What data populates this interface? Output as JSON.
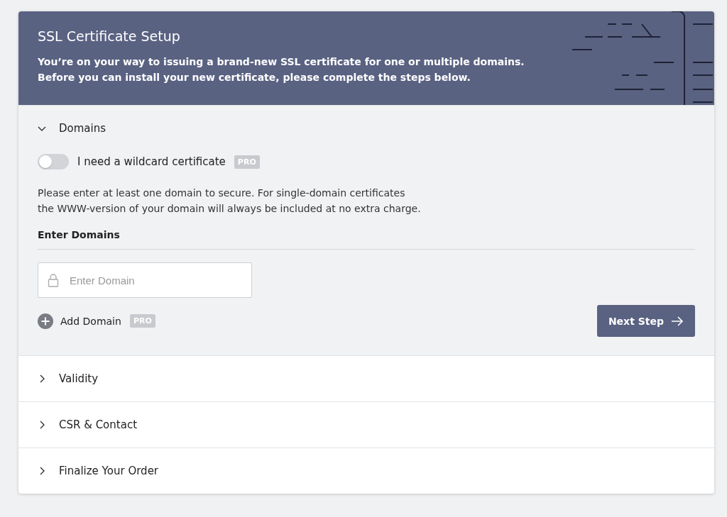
{
  "header": {
    "title": "SSL Certificate Setup",
    "description_lines": [
      "You’re on your way to issuing a brand-new SSL certificate for one or multiple domains.",
      "Before you can install your new certificate, please complete the steps below."
    ]
  },
  "sections": [
    {
      "title": "Domains",
      "expanded": true
    },
    {
      "title": "Validity",
      "expanded": false
    },
    {
      "title": "CSR & Contact",
      "expanded": false
    },
    {
      "title": "Finalize Your Order",
      "expanded": false
    }
  ],
  "domains": {
    "wildcard": {
      "label": "I need a wildcard certificate",
      "on": false,
      "badge": "PRO"
    },
    "info_lines": [
      "Please enter at least one domain to secure. For single-domain certificates",
      "the WWW-version of your domain will always be included at no extra charge."
    ],
    "heading": "Enter Domains",
    "domain_field": {
      "placeholder": "Enter Domain"
    },
    "add_domain": {
      "label": "Add Domain",
      "badge": "PRO"
    },
    "next_button": "Next Step"
  }
}
